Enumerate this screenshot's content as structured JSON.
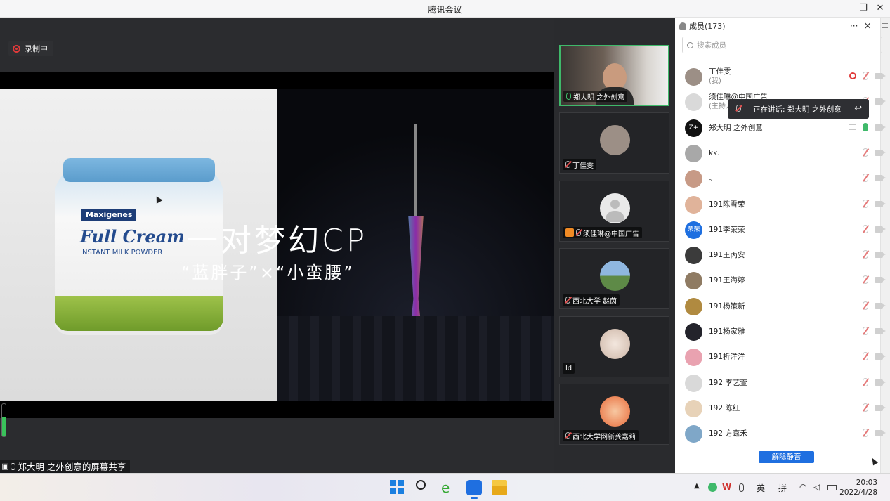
{
  "window": {
    "title": "腾讯会议"
  },
  "share": {
    "recording_label": "录制中",
    "slide_title": "一对梦幻CP",
    "slide_subtitle": "“蓝胖子”×“小蛮腰”",
    "product_brand": "Maxigenes",
    "product_name": "Full Cream",
    "product_sub": "INSTANT MILK POWDER",
    "sharer_label": "郑大明 之外创意的屏幕共享"
  },
  "videos": [
    {
      "name": "郑大明 之外创意",
      "mic": "on",
      "active": true
    },
    {
      "name": "丁佳雯",
      "mic": "muted"
    },
    {
      "name": "须佳琳@中国广告",
      "mic": "muted",
      "host_badge": true
    },
    {
      "name": "西北大学 赵茵",
      "mic": "muted"
    },
    {
      "name": "ld",
      "mic": "none"
    },
    {
      "name": "西北大学网新龚嘉莉",
      "mic": "muted"
    }
  ],
  "members_panel": {
    "title": "成员(173)",
    "more_icon": "···",
    "close_icon": "×",
    "search_placeholder": "搜索成员",
    "speaking_tooltip": "正在讲话: 郑大明 之外创意",
    "unmute_button": "解除静音",
    "members": [
      {
        "name": "丁佳雯",
        "role": "(我)",
        "avatar_color": "#9c8f86",
        "recording": true
      },
      {
        "name": "须佳琳@中国广告",
        "role": "(主持人)",
        "avatar_color": "#d9d9d9"
      },
      {
        "name": "郑大明 之外创意",
        "avatar_text": "Z+",
        "avatar_color": "#111111",
        "speaking": true,
        "sharing": true
      },
      {
        "name": "kk.",
        "avatar_color": "#a8a8a8"
      },
      {
        "name": "。",
        "avatar_color": "#c79a86"
      },
      {
        "name": "191陈雪荣",
        "avatar_color": "#e0b39a"
      },
      {
        "name": "191李荣荣",
        "avatar_text": "荣荣",
        "avatar_color": "#1e6fe0"
      },
      {
        "name": "191王丙安",
        "avatar_color": "#3b3b3b"
      },
      {
        "name": "191王海婷",
        "avatar_color": "#8f7b63"
      },
      {
        "name": "191杨策新",
        "avatar_color": "#b08a40"
      },
      {
        "name": "191杨家雅",
        "avatar_color": "#23232b"
      },
      {
        "name": "191折洋洋",
        "avatar_color": "#e9a2b0"
      },
      {
        "name": "192 李艺萱",
        "avatar_color": "#d9d9d9"
      },
      {
        "name": "192 陈红",
        "avatar_color": "#e7d2b8"
      },
      {
        "name": "192 方嘉禾",
        "avatar_color": "#7fa7c8"
      }
    ]
  },
  "taskbar": {
    "tray_lang_1": "英",
    "tray_lang_2": "拼",
    "time": "20:03",
    "date": "2022/4/28"
  }
}
